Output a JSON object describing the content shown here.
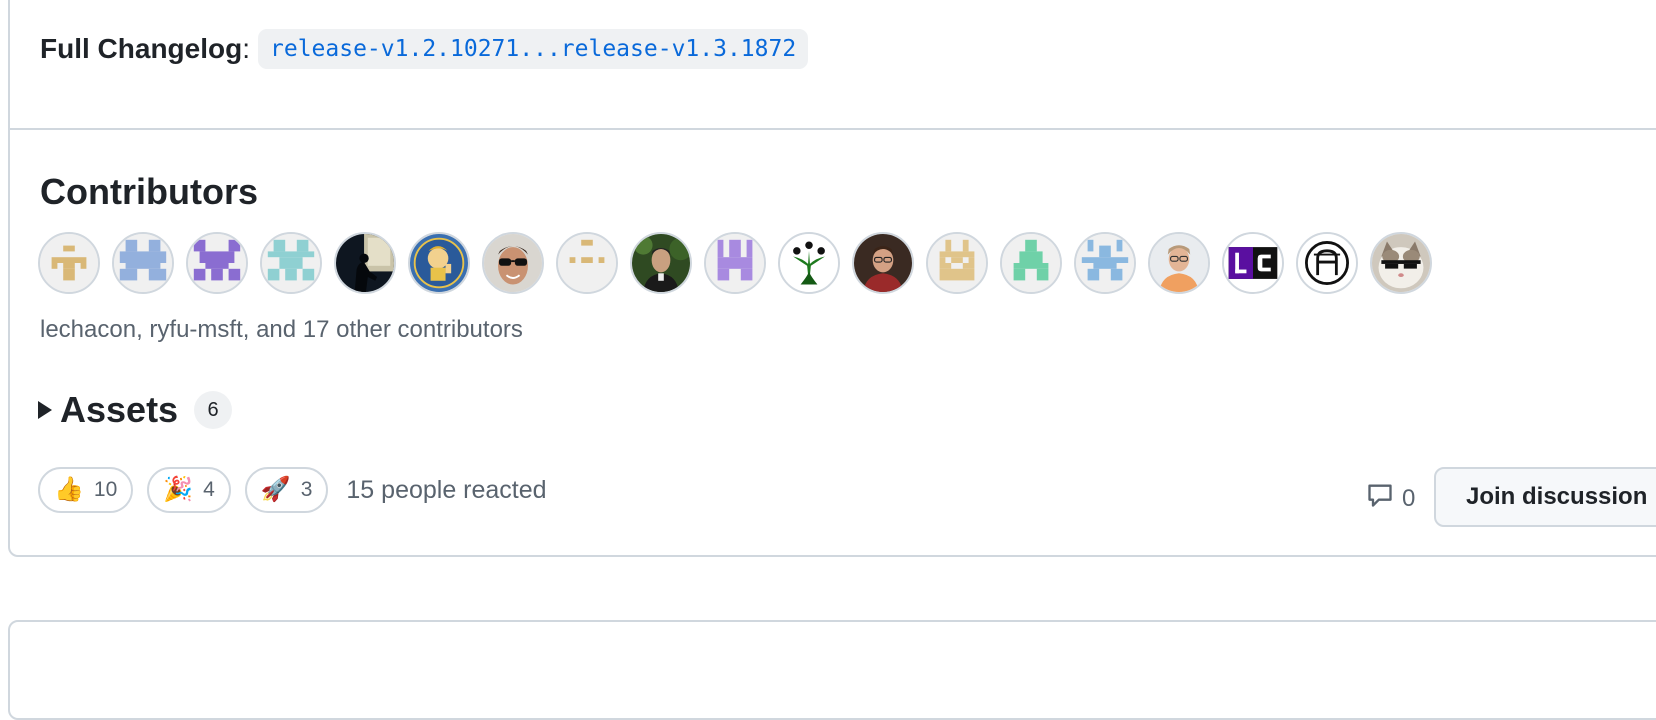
{
  "changelog": {
    "label": "Full Changelog",
    "colon": ":",
    "range": "release-v1.2.10271...release-v1.3.1872"
  },
  "contributors": {
    "title": "Contributors",
    "avatars": [
      {
        "user": "identicon-tan",
        "icon": "identicon"
      },
      {
        "user": "identicon-blue",
        "icon": "identicon"
      },
      {
        "user": "identicon-purple",
        "icon": "identicon"
      },
      {
        "user": "identicon-teal",
        "icon": "identicon"
      },
      {
        "user": "silhouette-photo",
        "icon": "photo"
      },
      {
        "user": "vault-boy-photo",
        "icon": "photo"
      },
      {
        "user": "sunglasses-photo",
        "icon": "photo"
      },
      {
        "user": "identicon-tan-dots",
        "icon": "identicon"
      },
      {
        "user": "forest-portrait",
        "icon": "photo"
      },
      {
        "user": "identicon-violet",
        "icon": "identicon"
      },
      {
        "user": "green-plant-logo",
        "icon": "logo"
      },
      {
        "user": "red-shirt-portrait",
        "icon": "photo"
      },
      {
        "user": "identicon-tan-2",
        "icon": "identicon"
      },
      {
        "user": "identicon-green",
        "icon": "identicon"
      },
      {
        "user": "identicon-lightblue",
        "icon": "identicon"
      },
      {
        "user": "orange-shirt-portrait",
        "icon": "photo"
      },
      {
        "user": "lc-logo",
        "icon": "logo"
      },
      {
        "user": "circle-a-logo",
        "icon": "logo"
      },
      {
        "user": "cat-sunglasses-photo",
        "icon": "photo"
      }
    ],
    "summary": "lechacon, ryfu-msft, and 17 other contributors"
  },
  "assets": {
    "label": "Assets",
    "count": "6"
  },
  "reactions": {
    "items": [
      {
        "emoji": "👍",
        "count": "10",
        "name": "thumbs-up"
      },
      {
        "emoji": "🎉",
        "count": "4",
        "name": "tada"
      },
      {
        "emoji": "🚀",
        "count": "3",
        "name": "rocket"
      }
    ],
    "summary": "15 people reacted"
  },
  "discussion": {
    "comment_count": "0",
    "join_label": "Join discussion"
  },
  "colors": {
    "link": "#0969da",
    "border": "#d0d7de",
    "muted": "#59636e"
  }
}
